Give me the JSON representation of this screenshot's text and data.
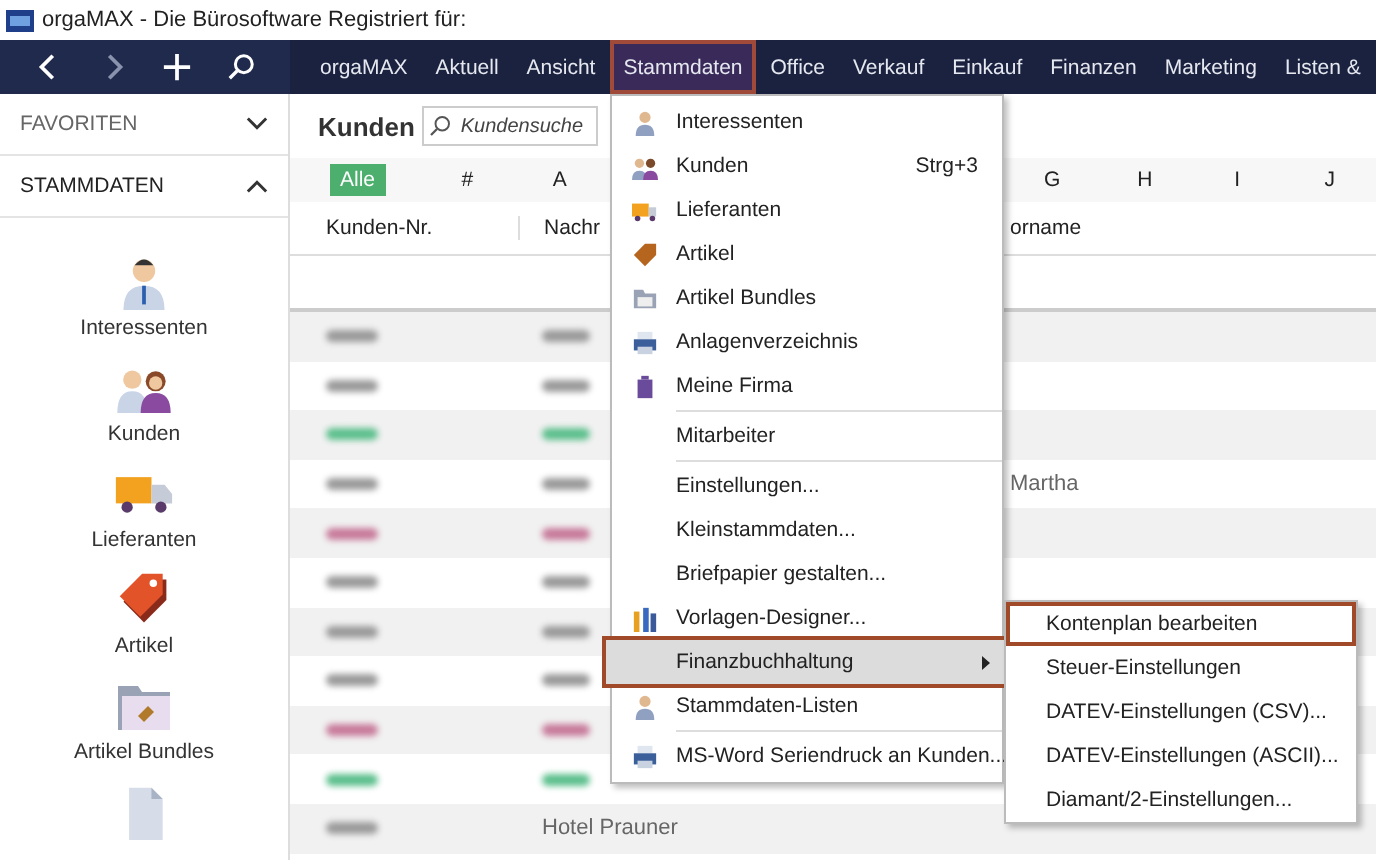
{
  "window": {
    "title": "orgaMAX - Die Bürosoftware Registriert für:"
  },
  "nav": {
    "menus": [
      {
        "label": "orgaMAX",
        "selected": false
      },
      {
        "label": "Aktuell",
        "selected": false
      },
      {
        "label": "Ansicht",
        "selected": false
      },
      {
        "label": "Stammdaten",
        "selected": true
      },
      {
        "label": "Office",
        "selected": false
      },
      {
        "label": "Verkauf",
        "selected": false
      },
      {
        "label": "Einkauf",
        "selected": false
      },
      {
        "label": "Finanzen",
        "selected": false
      },
      {
        "label": "Marketing",
        "selected": false
      },
      {
        "label": "Listen &",
        "selected": false
      }
    ]
  },
  "sidebar": {
    "sections": [
      {
        "label": "FAVORITEN",
        "expanded": false
      },
      {
        "label": "STAMMDATEN",
        "expanded": true
      }
    ],
    "items": [
      "Interessenten",
      "Kunden",
      "Lieferanten",
      "Artikel",
      "Artikel Bundles"
    ]
  },
  "content": {
    "title": "Kunden",
    "search": {
      "placeholder": "Kundensuche"
    },
    "letters": [
      {
        "label": "Alle",
        "selected": true
      },
      {
        "label": "#",
        "selected": false
      },
      {
        "label": "A",
        "selected": false
      },
      {
        "label": "G",
        "selected": false
      },
      {
        "label": "H",
        "selected": false
      },
      {
        "label": "I",
        "selected": false
      },
      {
        "label": "J",
        "selected": false
      }
    ],
    "table": {
      "columns": [
        "Kunden-Nr.",
        "Nachr",
        "orname"
      ],
      "rows": [
        {
          "color": "#9a9a9a",
          "name": "",
          "first_name": ""
        },
        {
          "color": "#9a9a9a",
          "name": "",
          "first_name": ""
        },
        {
          "color": "#5cbf8c",
          "name": "",
          "first_name": ""
        },
        {
          "color": "#9a9a9a",
          "name": "",
          "first_name": "Martha"
        },
        {
          "color": "#c77a9a",
          "name": "",
          "first_name": ""
        },
        {
          "color": "#9a9a9a",
          "name": "",
          "first_name": ""
        },
        {
          "color": "#9a9a9a",
          "name": "",
          "first_name": ""
        },
        {
          "color": "#9a9a9a",
          "name": "",
          "first_name": ""
        },
        {
          "color": "#c77a9a",
          "name": "",
          "first_name": ""
        },
        {
          "color": "#5cbf8c",
          "name": "",
          "first_name": ""
        },
        {
          "color": "#9a9a9a",
          "name": "Hotel Prauner",
          "first_name": ""
        }
      ]
    }
  },
  "menu": {
    "items": [
      {
        "kind": "item",
        "label": "Interessenten",
        "selected": false
      },
      {
        "kind": "item",
        "label": "Kunden",
        "shortcut": "Strg+3",
        "selected": false
      },
      {
        "kind": "item",
        "label": "Lieferanten",
        "selected": false
      },
      {
        "kind": "item",
        "label": "Artikel",
        "selected": false
      },
      {
        "kind": "item",
        "label": "Artikel Bundles",
        "selected": false
      },
      {
        "kind": "item",
        "label": "Anlagenverzeichnis",
        "selected": false
      },
      {
        "kind": "item",
        "label": "Meine Firma",
        "selected": false
      },
      {
        "kind": "separator"
      },
      {
        "kind": "item",
        "label": "Mitarbeiter",
        "selected": false
      },
      {
        "kind": "separator"
      },
      {
        "kind": "item",
        "label": "Einstellungen...",
        "selected": false
      },
      {
        "kind": "item",
        "label": "Kleinstammdaten...",
        "selected": false
      },
      {
        "kind": "item",
        "label": "Briefpapier gestalten...",
        "selected": false
      },
      {
        "kind": "item",
        "label": "Vorlagen-Designer...",
        "selected": false
      },
      {
        "kind": "submenu",
        "label": "Finanzbuchhaltung",
        "selected": true
      },
      {
        "kind": "item",
        "label": "Stammdaten-Listen",
        "selected": false
      },
      {
        "kind": "separator"
      },
      {
        "kind": "item",
        "label": "MS-Word Seriendruck an Kunden...",
        "selected": false
      }
    ]
  },
  "submenu": {
    "items": [
      {
        "label": "Kontenplan bearbeiten",
        "selected": true
      },
      {
        "label": "Steuer-Einstellungen",
        "selected": false
      },
      {
        "label": "DATEV-Einstellungen (CSV)...",
        "selected": false
      },
      {
        "label": "DATEV-Einstellungen (ASCII)...",
        "selected": false
      },
      {
        "label": "Diamant/2-Einstellungen...",
        "selected": false
      }
    ]
  }
}
